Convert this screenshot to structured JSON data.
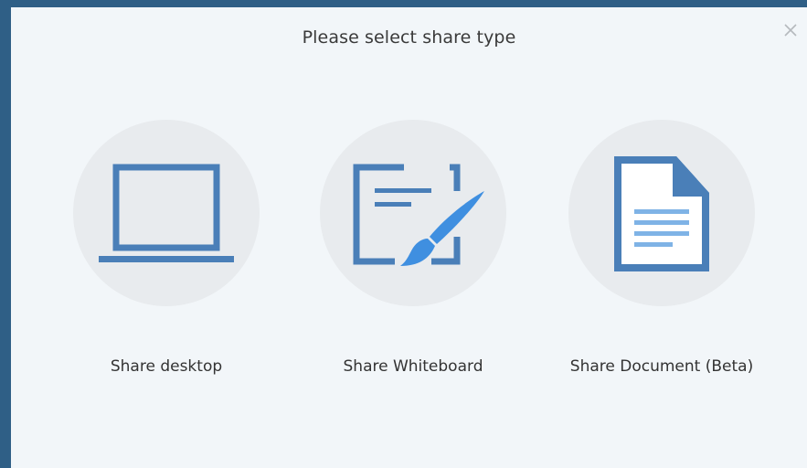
{
  "dialog": {
    "title": "Please select share type",
    "close_icon": "close-icon"
  },
  "options": [
    {
      "label": "Share desktop",
      "icon": "laptop-icon"
    },
    {
      "label": "Share Whiteboard",
      "icon": "whiteboard-brush-icon"
    },
    {
      "label": "Share Document (Beta)",
      "icon": "document-icon"
    }
  ],
  "colors": {
    "icon_blue": "#4a7fb8",
    "icon_light_blue": "#7fb3e6",
    "brush_blue": "#3f8fe0",
    "circle_bg": "#e8ebee",
    "dialog_bg": "#f2f6f9"
  }
}
